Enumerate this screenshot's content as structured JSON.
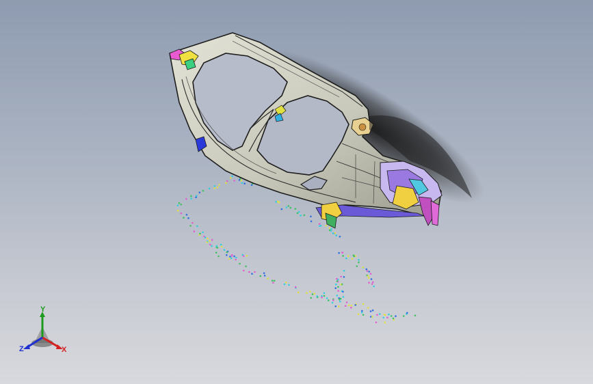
{
  "viewport": {
    "background_top": "#8e9bb0",
    "background_bottom": "#d8d9de"
  },
  "model": {
    "shading": "shaded-with-edges",
    "body_color": "#cfcfc2",
    "edge_color": "#1c1c1c",
    "shadow": true
  },
  "reference_triad": {
    "x_label": "X",
    "y_label": "Y",
    "z_label": "Z",
    "x_color": "#d42020",
    "y_color": "#1c9a1c",
    "z_color": "#2030d0"
  }
}
